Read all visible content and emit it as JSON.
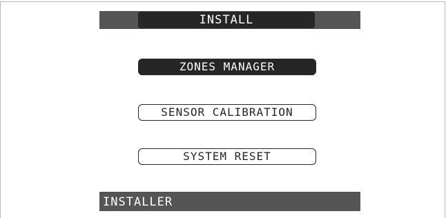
{
  "header": {
    "title": "INSTALL"
  },
  "menu": {
    "items": [
      {
        "label": "ZONES MANAGER",
        "selected": true
      },
      {
        "label": "SENSOR CALIBRATION",
        "selected": false
      },
      {
        "label": "SYSTEM RESET",
        "selected": false
      }
    ]
  },
  "footer": {
    "label": "INSTALLER"
  },
  "colors": {
    "bar": "#555555",
    "dark": "#262626",
    "background": "#ffffff",
    "text_light": "#ffffff"
  }
}
